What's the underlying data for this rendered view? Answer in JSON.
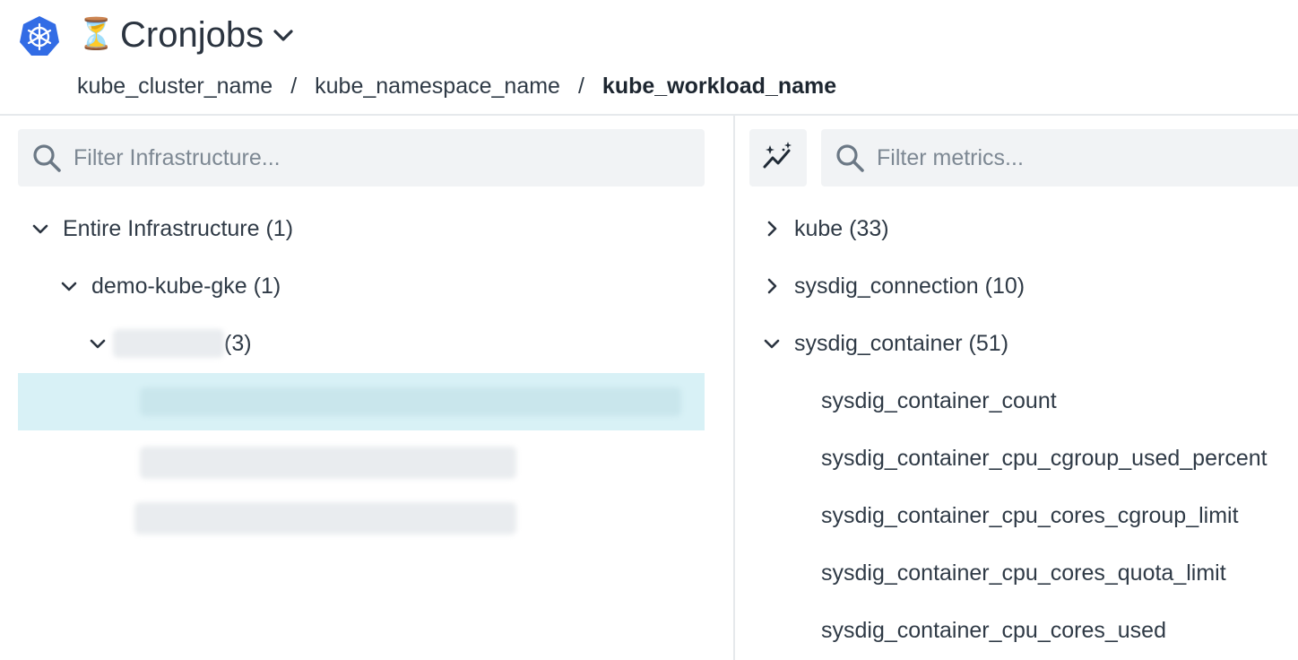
{
  "header": {
    "logo_icon": "kubernetes-logo",
    "emoji": "⏳",
    "title": "Cronjobs",
    "breadcrumb": [
      "kube_cluster_name",
      "/",
      "kube_namespace_name",
      "/",
      "kube_workload_name"
    ]
  },
  "infra": {
    "search_placeholder": "Filter Infrastructure...",
    "tree": {
      "root_label": "Entire Infrastructure (1)",
      "cluster_label": "demo-kube-gke (1)",
      "namespace_count": "(3)"
    }
  },
  "metrics": {
    "search_placeholder": "Filter metrics...",
    "groups": [
      {
        "label": "kube (33)",
        "expanded": false
      },
      {
        "label": "sysdig_connection (10)",
        "expanded": false
      },
      {
        "label": "sysdig_container (51)",
        "expanded": true
      }
    ],
    "leaves": [
      "sysdig_container_count",
      "sysdig_container_cpu_cgroup_used_percent",
      "sysdig_container_cpu_cores_cgroup_limit",
      "sysdig_container_cpu_cores_quota_limit",
      "sysdig_container_cpu_cores_used"
    ]
  },
  "colors": {
    "accent_blue": "#326ce5",
    "selected_row": "#d8f1f6",
    "search_bg": "#f1f3f5"
  }
}
